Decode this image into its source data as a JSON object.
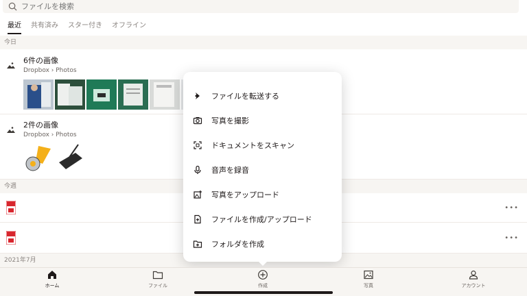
{
  "search": {
    "placeholder": "ファイルを検索"
  },
  "tabs": [
    {
      "label": "最近"
    },
    {
      "label": "共有済み"
    },
    {
      "label": "スター付き"
    },
    {
      "label": "オフライン"
    }
  ],
  "sections": {
    "today": "今日",
    "this_week": "今週",
    "month": "2021年7月"
  },
  "recent": [
    {
      "title": "6件の画像",
      "path": "Dropbox › Photos"
    },
    {
      "title": "2件の画像",
      "path": "Dropbox › Photos"
    }
  ],
  "more_label": "•••",
  "menu": {
    "items": [
      {
        "label": "ファイルを転送する",
        "icon": "transfer-icon"
      },
      {
        "label": "写真を撮影",
        "icon": "camera-icon"
      },
      {
        "label": "ドキュメントをスキャン",
        "icon": "scan-icon"
      },
      {
        "label": "音声を録音",
        "icon": "microphone-icon"
      },
      {
        "label": "写真をアップロード",
        "icon": "photo-upload-icon"
      },
      {
        "label": "ファイルを作成/アップロード",
        "icon": "file-upload-icon"
      },
      {
        "label": "フォルダを作成",
        "icon": "folder-add-icon"
      }
    ]
  },
  "nav": [
    {
      "label": "ホーム",
      "icon": "home-icon"
    },
    {
      "label": "ファイル",
      "icon": "folder-icon"
    },
    {
      "label": "作成",
      "icon": "plus-circle-icon"
    },
    {
      "label": "写真",
      "icon": "photo-icon"
    },
    {
      "label": "アカウント",
      "icon": "account-icon"
    }
  ],
  "colors": {
    "accent": "#0061fe",
    "text": "#1e1919",
    "muted": "#8a8480",
    "panel": "#f7f5f2",
    "pdf_red": "#d8262e"
  }
}
